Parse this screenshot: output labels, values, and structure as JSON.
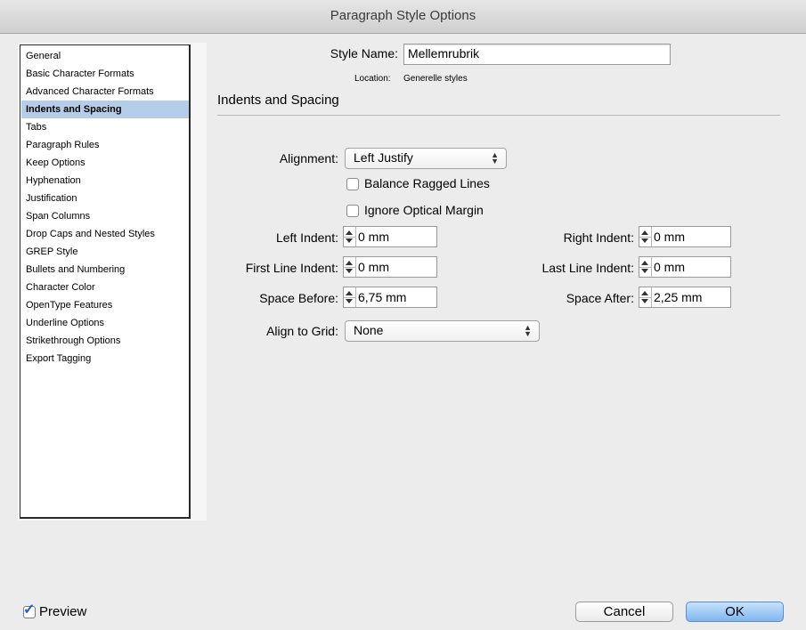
{
  "window": {
    "title": "Paragraph Style Options"
  },
  "sidebar": {
    "selected_index": 3,
    "items": [
      {
        "label": "General"
      },
      {
        "label": "Basic Character Formats"
      },
      {
        "label": "Advanced Character Formats"
      },
      {
        "label": "Indents and Spacing"
      },
      {
        "label": "Tabs"
      },
      {
        "label": "Paragraph Rules"
      },
      {
        "label": "Keep Options"
      },
      {
        "label": "Hyphenation"
      },
      {
        "label": "Justification"
      },
      {
        "label": "Span Columns"
      },
      {
        "label": "Drop Caps and Nested Styles"
      },
      {
        "label": "GREP Style"
      },
      {
        "label": "Bullets and Numbering"
      },
      {
        "label": "Character Color"
      },
      {
        "label": "OpenType Features"
      },
      {
        "label": "Underline Options"
      },
      {
        "label": "Strikethrough Options"
      },
      {
        "label": "Export Tagging"
      }
    ]
  },
  "style": {
    "name_label": "Style Name:",
    "name_value": "Mellemrubrik",
    "location_label": "Location:",
    "location_value": "Generelle styles"
  },
  "section": {
    "title": "Indents and Spacing"
  },
  "form": {
    "alignment_label": "Alignment:",
    "alignment_value": "Left Justify",
    "balance_ragged_label": "Balance Ragged Lines",
    "balance_ragged_checked": false,
    "ignore_optical_label": "Ignore Optical Margin",
    "ignore_optical_checked": false,
    "left_indent_label": "Left Indent:",
    "left_indent_value": "0 mm",
    "right_indent_label": "Right Indent:",
    "right_indent_value": "0 mm",
    "first_line_indent_label": "First Line Indent:",
    "first_line_indent_value": "0 mm",
    "last_line_indent_label": "Last Line Indent:",
    "last_line_indent_value": "0 mm",
    "space_before_label": "Space Before:",
    "space_before_value": "6,75 mm",
    "space_after_label": "Space After:",
    "space_after_value": "2,25 mm",
    "align_grid_label": "Align to Grid:",
    "align_grid_value": "None"
  },
  "footer": {
    "preview_label": "Preview",
    "preview_checked": true,
    "cancel_label": "Cancel",
    "ok_label": "OK"
  },
  "colors": {
    "selection": "#b5cde8",
    "ok_button": "#7fb6ee",
    "checkmark": "#1b5fd3"
  }
}
